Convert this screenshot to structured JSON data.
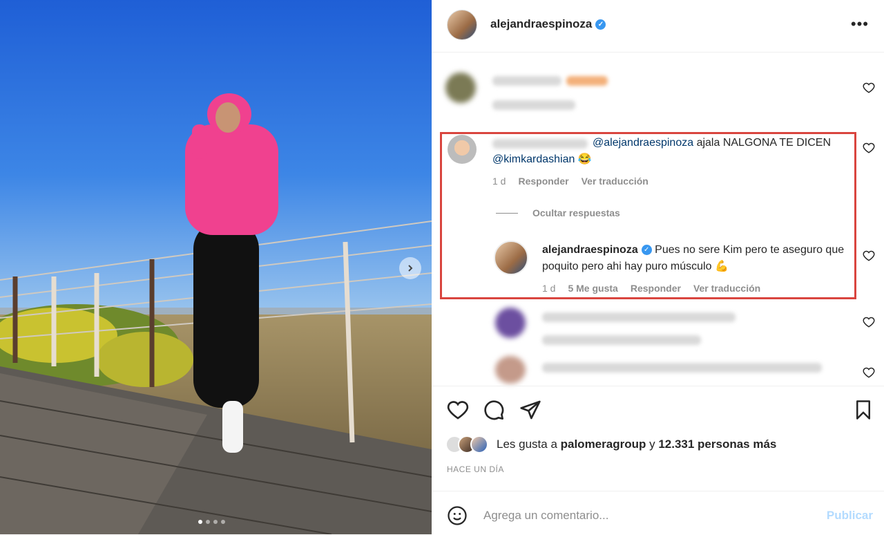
{
  "post": {
    "username": "alejandraespinoza",
    "verified_icon": "verified-badge-icon",
    "more_icon": "more-options-icon",
    "more_label": "•••"
  },
  "comments": {
    "main": {
      "text_mention": "@alejandraespinoza",
      "text_body": " ajala NALGONA TE DICEN ",
      "text_mention2": "@kimkardashian",
      "emoji": "😂",
      "age": "1 d",
      "reply_label": "Responder",
      "translate_label": "Ver traducción"
    },
    "hide_replies_label": "Ocultar respuestas",
    "reply": {
      "username": "alejandraespinoza",
      "text": "Pues no sere Kim pero te aseguro que poquito pero ahi hay puro músculo",
      "emoji": "💪",
      "age": "1 d",
      "likes_label": "5 Me gusta",
      "reply_label": "Responder",
      "translate_label": "Ver traducción"
    }
  },
  "likes": {
    "prefix": "Les gusta a ",
    "user": "palomeragroup",
    "middle": " y ",
    "count": "12.331 personas más"
  },
  "timestamp": "HACE UN DÍA",
  "add_comment": {
    "placeholder": "Agrega un comentario...",
    "publish_label": "Publicar"
  },
  "carousel": {
    "total_slides": 4,
    "active_slide": 1
  }
}
